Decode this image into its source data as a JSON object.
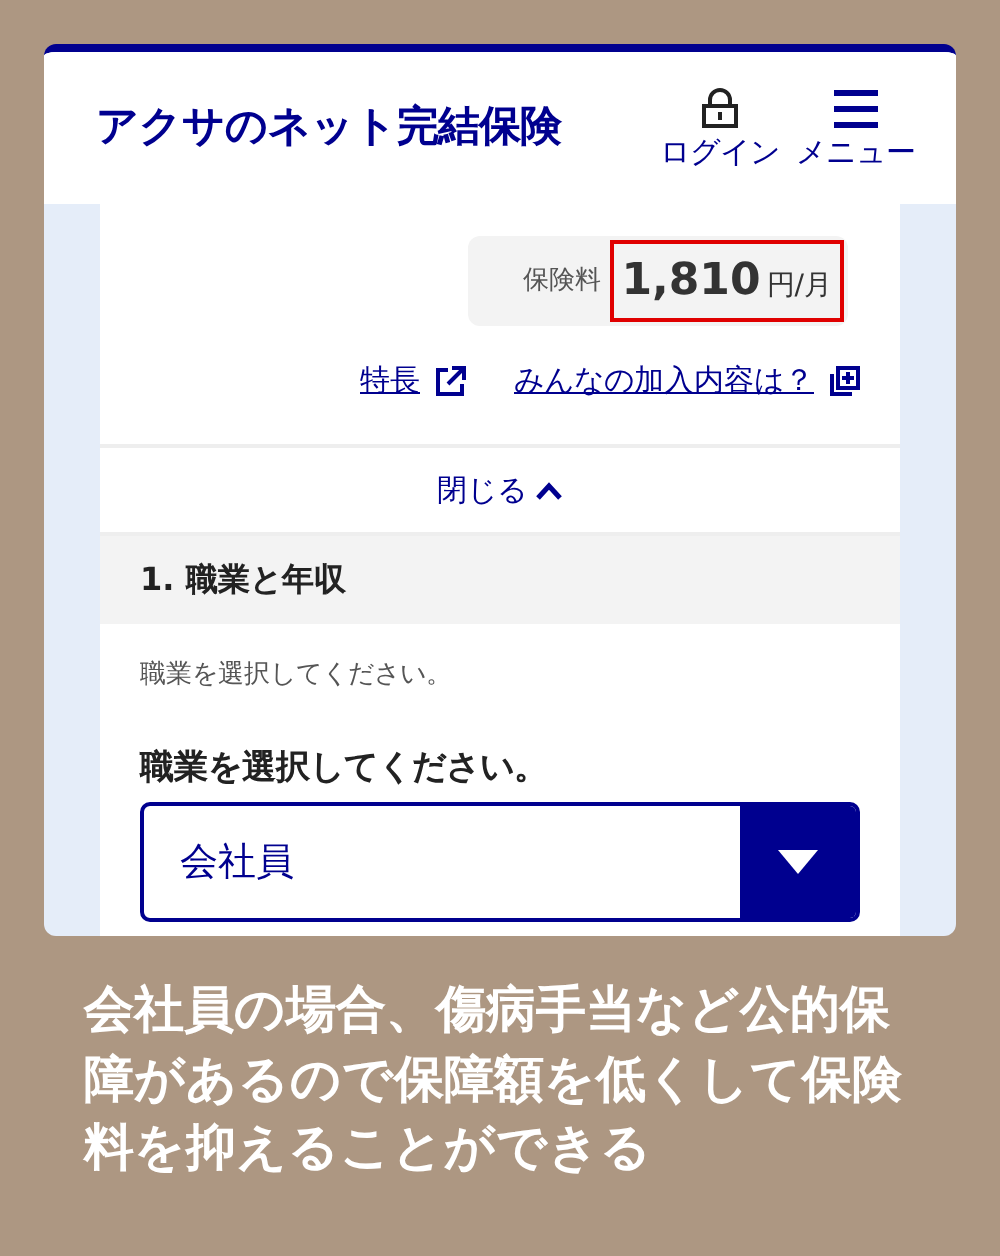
{
  "header": {
    "title": "アクサのネット完結保険",
    "actions": [
      {
        "kind": "login",
        "label": "ログイン"
      },
      {
        "kind": "menu",
        "label": "メニュー"
      }
    ]
  },
  "premium": {
    "label": "保険料",
    "amount": "1,810",
    "unit": "円/月",
    "highlighted": true
  },
  "links": [
    {
      "kind": "external",
      "label": "特長"
    },
    {
      "kind": "popup",
      "label": "みんなの加入内容は？"
    }
  ],
  "collapse": {
    "label": "閉じる",
    "expanded": true
  },
  "section": {
    "title": "1. 職業と年収",
    "hint": "職業を選択してください。",
    "field_label": "職業を選択してください。",
    "select_value": "会社員"
  },
  "caption": "会社員の場合、傷病手当など公的保障があるので保障額を低くして保険料を抑えることができる"
}
